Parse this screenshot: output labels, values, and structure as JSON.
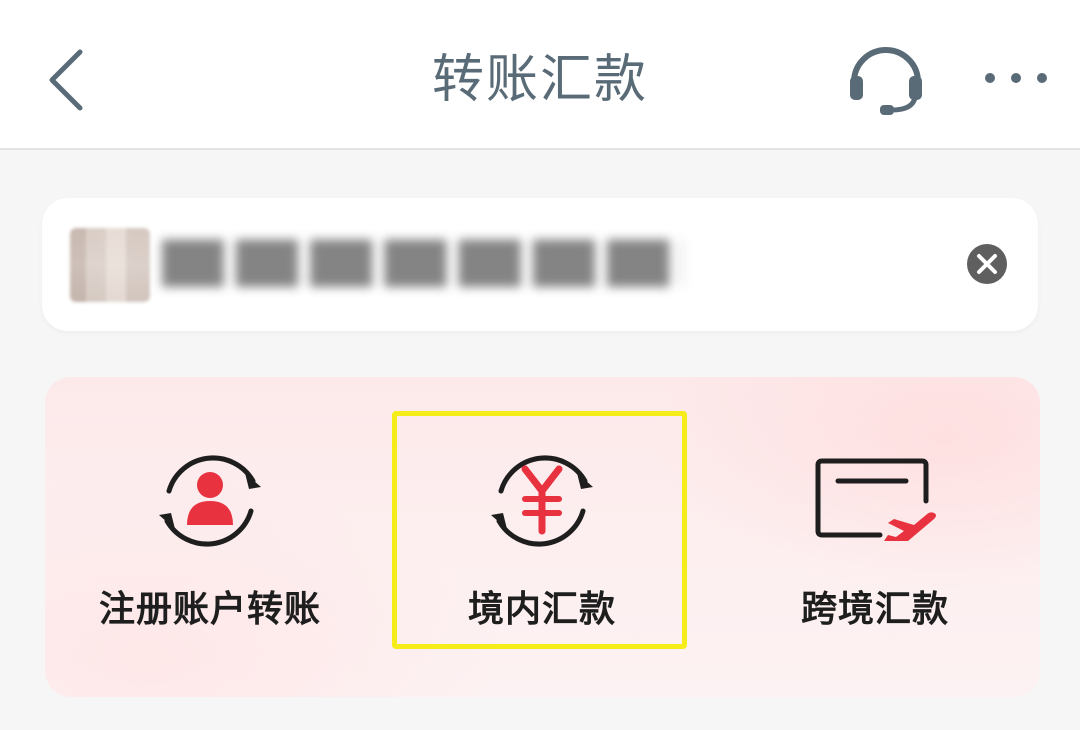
{
  "header": {
    "title": "转账汇款",
    "back_icon": "chevron-left-icon",
    "service_icon": "headset-icon",
    "more_icon": "more-dots-icon"
  },
  "notice": {
    "text": "(blurred)",
    "thumbnail": "blurred-thumbnail",
    "close_icon": "close-circle-icon"
  },
  "actions": [
    {
      "label": "注册账户转账",
      "icon": "person-exchange-icon"
    },
    {
      "label": "境内汇款",
      "icon": "yuan-exchange-icon"
    },
    {
      "label": "跨境汇款",
      "icon": "cross-border-plane-icon"
    }
  ],
  "colors": {
    "accent_red": "#e8323f",
    "title_gray": "#5a6b78",
    "highlight_yellow": "#f5ec1a",
    "panel_pink": "#fde9ea"
  }
}
